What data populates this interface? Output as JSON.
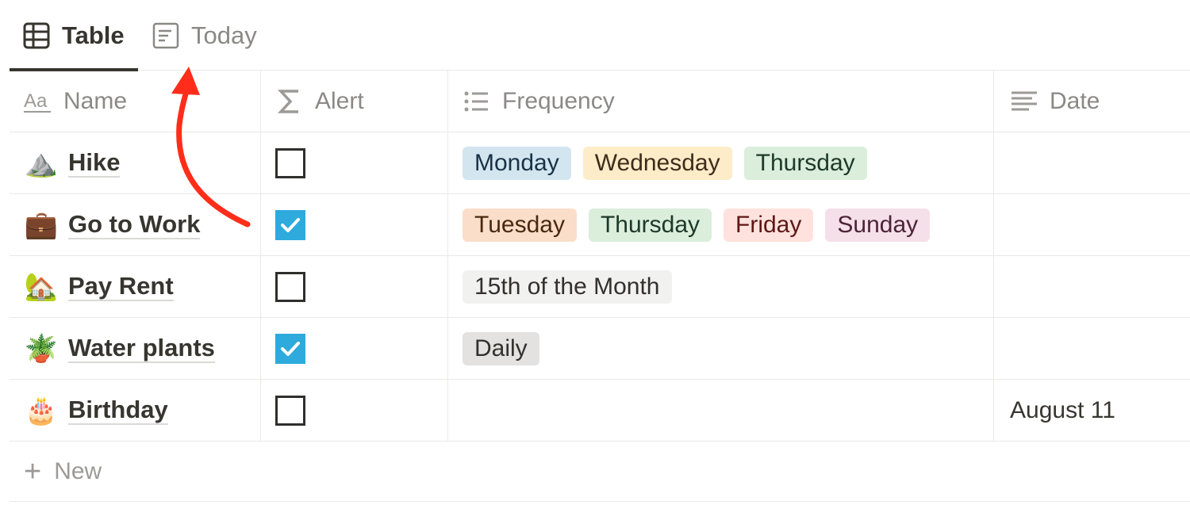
{
  "tabs": [
    {
      "label": "Table",
      "icon": "table-grid-icon",
      "active": true
    },
    {
      "label": "Today",
      "icon": "calendar-doc-icon",
      "active": false
    }
  ],
  "columns": {
    "name": {
      "label": "Name",
      "icon": "text-aa-icon"
    },
    "alert": {
      "label": "Alert",
      "icon": "sigma-formula-icon"
    },
    "frequency": {
      "label": "Frequency",
      "icon": "list-bullets-icon"
    },
    "date": {
      "label": "Date",
      "icon": "text-lines-icon"
    }
  },
  "rows": [
    {
      "emoji": "⛰️",
      "name": "Hike",
      "alert": false,
      "tags": [
        {
          "label": "Monday",
          "bg": "#d3e5ef",
          "fg": "#183347"
        },
        {
          "label": "Wednesday",
          "bg": "#fdecc8",
          "fg": "#402c1b"
        },
        {
          "label": "Thursday",
          "bg": "#dbeddb",
          "fg": "#1c3829"
        }
      ],
      "date": ""
    },
    {
      "emoji": "💼",
      "name": "Go to Work",
      "alert": true,
      "tags": [
        {
          "label": "Tuesday",
          "bg": "#fadec9",
          "fg": "#49290e"
        },
        {
          "label": "Thursday",
          "bg": "#dbeddb",
          "fg": "#1c3829"
        },
        {
          "label": "Friday",
          "bg": "#ffe2dd",
          "fg": "#5d1715"
        },
        {
          "label": "Sunday",
          "bg": "#f5e0e9",
          "fg": "#4c2337"
        }
      ],
      "date": ""
    },
    {
      "emoji": "🏡",
      "name": "Pay Rent",
      "alert": false,
      "tags": [
        {
          "label": "15th of the Month",
          "bg": "#f1f1ef",
          "fg": "#32302c"
        }
      ],
      "date": ""
    },
    {
      "emoji": "🪴",
      "name": "Water plants",
      "alert": true,
      "tags": [
        {
          "label": "Daily",
          "bg": "#e3e2e0",
          "fg": "#32302c"
        }
      ],
      "date": ""
    },
    {
      "emoji": "🎂",
      "name": "Birthday",
      "alert": false,
      "tags": [],
      "date": "August 11"
    }
  ],
  "new_row": {
    "label": "New"
  },
  "colors": {
    "checkbox_checked": "#2eaadc",
    "annotation_arrow": "#ff2d1a"
  }
}
